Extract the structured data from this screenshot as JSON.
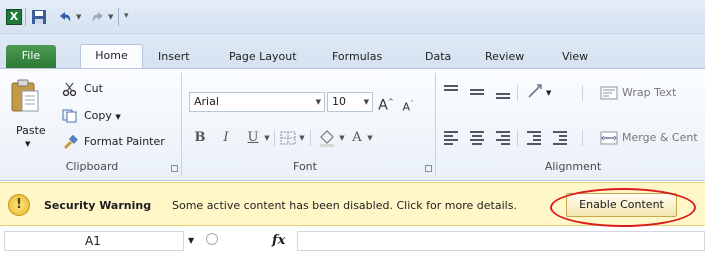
{
  "app": {
    "logo_letter": "X",
    "qat_separator": "|"
  },
  "tabs": [
    "File",
    "Home",
    "Insert",
    "Page Layout",
    "Formulas",
    "Data",
    "Review",
    "View"
  ],
  "clipboard": {
    "paste": "Paste",
    "cut": "Cut",
    "copy": "Copy",
    "format_painter": "Format Painter",
    "group_label": "Clipboard"
  },
  "font": {
    "name": "Arial",
    "size": "10",
    "grow": "A",
    "shrink": "A",
    "bold": "B",
    "italic": "I",
    "underline": "U",
    "font_color": "A",
    "group_label": "Font"
  },
  "alignment": {
    "wrap_text": "Wrap Text",
    "merge_center": "Merge & Cent",
    "group_label": "Alignment"
  },
  "security": {
    "icon": "!",
    "title": "Security Warning",
    "message": "Some active content has been disabled. Click for more details.",
    "button": "Enable Content",
    "highlight_color": "#d91c1c"
  },
  "formula_bar": {
    "cell_ref": "A1",
    "fx": "fx",
    "value": ""
  }
}
